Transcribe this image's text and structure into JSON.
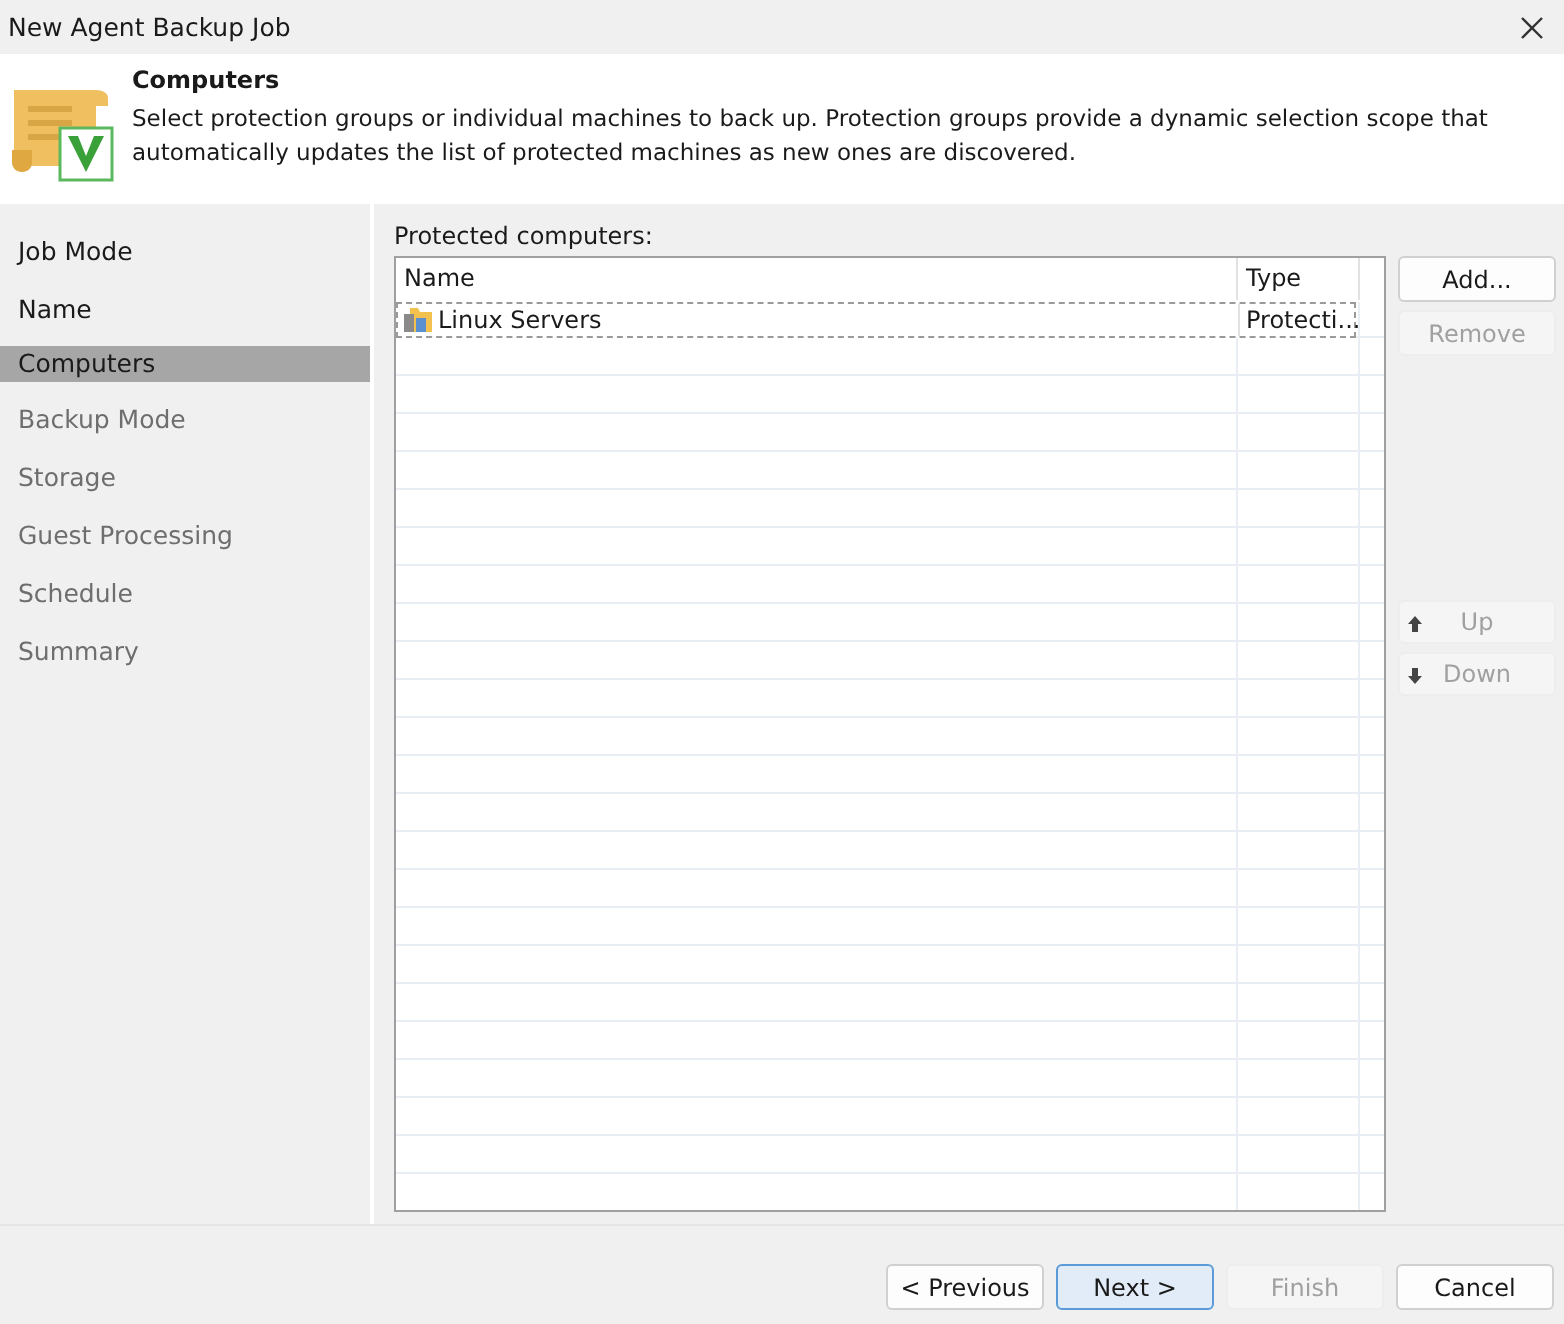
{
  "window": {
    "title": "New Agent Backup Job"
  },
  "header": {
    "title": "Computers",
    "description": "Select protection groups or individual machines to back up. Protection groups provide a dynamic selection scope that automatically updates the list of protected machines as new ones are discovered."
  },
  "steps": [
    {
      "label": "Job Mode",
      "selected": false,
      "disabled": false
    },
    {
      "label": "Name",
      "selected": false,
      "disabled": false
    },
    {
      "label": "Computers",
      "selected": true,
      "disabled": false
    },
    {
      "label": "Backup Mode",
      "selected": false,
      "disabled": true
    },
    {
      "label": "Storage",
      "selected": false,
      "disabled": true
    },
    {
      "label": "Guest Processing",
      "selected": false,
      "disabled": true
    },
    {
      "label": "Schedule",
      "selected": false,
      "disabled": true
    },
    {
      "label": "Summary",
      "selected": false,
      "disabled": true
    }
  ],
  "table": {
    "label": "Protected computers:",
    "columns": [
      "Name",
      "Type"
    ],
    "rows": [
      {
        "name": "Linux Servers",
        "type": "Protecti...",
        "selected": true
      }
    ]
  },
  "side_buttons": [
    {
      "label": "Add...",
      "disabled": false,
      "kind": "plain"
    },
    {
      "label": "Remove",
      "disabled": true,
      "kind": "plain"
    },
    {
      "label": "Up",
      "disabled": true,
      "kind": "up"
    },
    {
      "label": "Down",
      "disabled": true,
      "kind": "down"
    }
  ],
  "footer_buttons": [
    {
      "label": "< Previous",
      "disabled": false,
      "default": false
    },
    {
      "label": "Next >",
      "disabled": false,
      "default": true
    },
    {
      "label": "Finish",
      "disabled": true,
      "default": false
    },
    {
      "label": "Cancel",
      "disabled": false,
      "default": false
    }
  ]
}
